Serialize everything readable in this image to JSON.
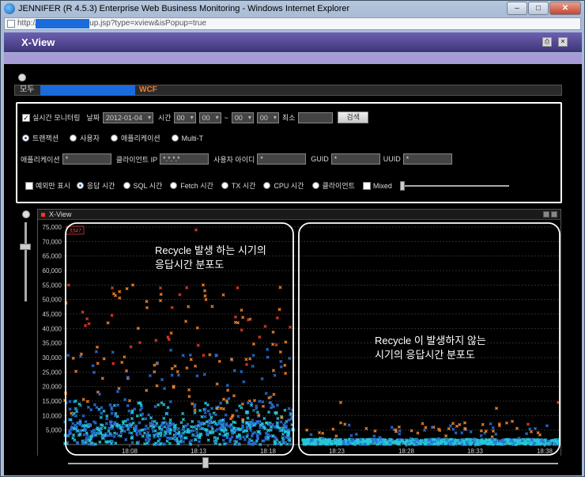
{
  "window": {
    "title": "JENNIFER (R 4.5.3) Enterprise Web Business Monitoring - Windows Internet Explorer",
    "minimize": "–",
    "maximize": "□",
    "close": "✕"
  },
  "address": {
    "url": "http://            000/main_popup.jsp?type=xview&isPopup=true"
  },
  "app": {
    "title": "X-View",
    "print_icon": "print-icon",
    "close_icon": "close-icon"
  },
  "breadcrumb": {
    "all": "모두",
    "wcf": "WCF"
  },
  "filters": {
    "realtime_label": "실시간 모니터링",
    "date_label": "날짜",
    "date_value": "2012-01-04",
    "time_label": "시간",
    "time_h1": "00",
    "time_m1": "00",
    "tilde": "~",
    "time_h2": "00",
    "time_m2": "00",
    "min_label": "최소",
    "search_button": "검색",
    "radio_transaction": "트랜잭션",
    "radio_user": "사용자",
    "radio_application": "애플리케이션",
    "radio_multit": "Multi-T",
    "app_label": "애플리케이션",
    "app_value": "*",
    "client_ip_label": "클라이언트 IP",
    "client_ip_value": "*.*.*.*",
    "user_id_label": "사용자 아이디",
    "user_id_value": "*",
    "guid_label": "GUID",
    "guid_value": "*",
    "uuid_label": "UUID",
    "uuid_value": "*",
    "exception_only": "예외만 표시",
    "metric_response": "응답 시간",
    "metric_sql": "SQL 시간",
    "metric_fetch": "Fetch 시간",
    "metric_tx": "TX 시간",
    "metric_cpu": "CPU 시간",
    "metric_client": "클라이언트",
    "mixed": "Mixed"
  },
  "chart_window": {
    "title": "X-View",
    "count_badge": "3347"
  },
  "chart_data": {
    "type": "scatter",
    "ylim": [
      0,
      75000
    ],
    "yticks": [
      "75,000",
      "70,000",
      "65,000",
      "60,000",
      "55,000",
      "50,000",
      "45,000",
      "40,000",
      "35,000",
      "30,000",
      "25,000",
      "20,000",
      "15,000",
      "10,000",
      "5,000"
    ],
    "xticks": [
      "18:08",
      "18:13",
      "18:18",
      "18:23",
      "18:28",
      "18:33",
      "18:38"
    ],
    "annotations": [
      "Recycle 발생 하는 시기의",
      "응답시간 분포도",
      "Recycle 이 발생하지 않는",
      "시기의 응답시간 분포도"
    ],
    "colors": {
      "blue": "#2a6fd6",
      "cyan": "#26c7d8",
      "orange": "#f0822d",
      "red": "#e23b2b",
      "highlight": "#ffffff"
    }
  }
}
